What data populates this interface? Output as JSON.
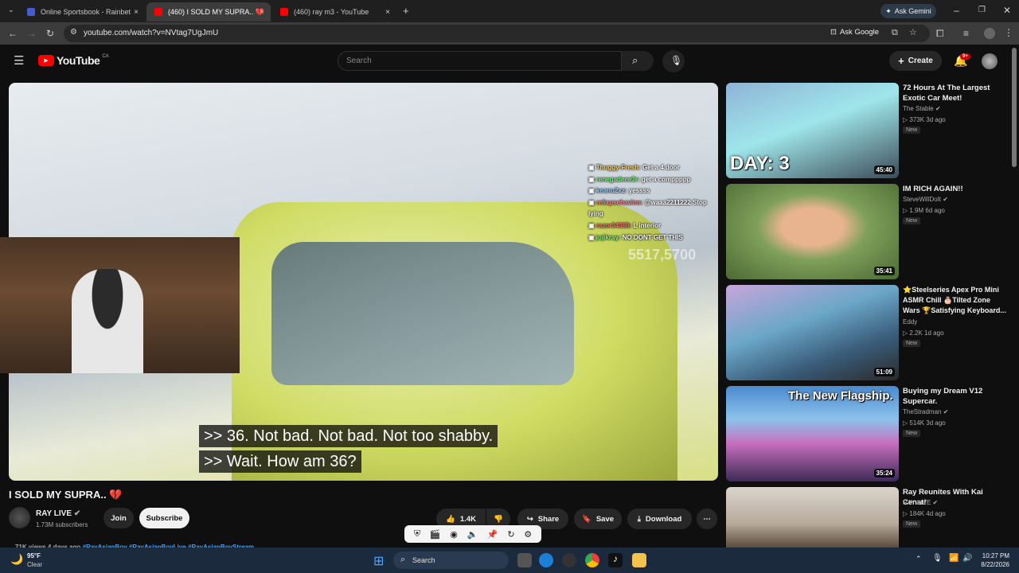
{
  "browser": {
    "tabs": [
      {
        "label": "Online Sportsbook - Rainbet",
        "active": false,
        "favicon_color": "#4a5bd0"
      },
      {
        "label": "(460) I SOLD MY SUPRA.. 💔",
        "active": true,
        "favicon_color": "#ff0000"
      },
      {
        "label": "(460) ray m3 - YouTube",
        "active": false,
        "favicon_color": "#ff0000"
      }
    ],
    "new_tab_label": "+",
    "close_label": "×",
    "ask_gemini": "Ask Gemini",
    "url": "youtube.com/watch?v=NVtag7UgJmU",
    "ask_google": "Ask Google"
  },
  "header": {
    "logo_text": "YouTube",
    "country": "CA",
    "search_placeholder": "Search",
    "create_label": "Create",
    "notifications_badge": "9+"
  },
  "video": {
    "chat_lines": [
      {
        "name": "Thuggy-Fresh:",
        "msg": "Get a 4 door",
        "cls": "n3"
      },
      {
        "name": "renegadeee3r:",
        "msg": "get a comppppp",
        "cls": "n2"
      },
      {
        "name": "keanu2xz:",
        "msg": "yessss",
        "cls": "n2"
      },
      {
        "name": "relixpsehavinn:",
        "msg": "@waaa2211222 Stop lying",
        "cls": "n1"
      },
      {
        "name": "razor34388:",
        "msg": "L interior",
        "cls": "n4"
      },
      {
        "name": "jojikray:",
        "msg": "NO DONT GET THIS",
        "cls": "n2"
      }
    ],
    "overlay_number": "5517,5700",
    "captions": [
      ">> 36. Not bad. Not bad. Not too shabby.",
      ">> Wait. How am 36?"
    ],
    "title": "I SOLD MY SUPRA.. 💔",
    "channel": "RAY LIVE",
    "subscribers": "1.73M subscribers",
    "join_label": "Join",
    "subscribe_label": "Subscribe",
    "likes": "1.4K",
    "share_label": "Share",
    "save_label": "Save",
    "download_label": "Download",
    "views_date": "71K views  4 days ago",
    "hashtags": "#RayAsianBoy #RayAsianBoyLive #RayAsianBoyStream"
  },
  "recommendations": [
    {
      "title": "72 Hours At The Largest Exotic Car Meet!",
      "channel": "The Stable",
      "stats": "▷ 373K  3d ago",
      "badge": "New",
      "duration": "45:40",
      "thumb_text": "DAY: 3"
    },
    {
      "title": "IM RICH AGAIN!!",
      "channel": "SteveWillDoIt",
      "stats": "▷ 1.9M  6d ago",
      "badge": "New",
      "duration": "35:41",
      "thumb_text": ""
    },
    {
      "title": "⭐Steelseries Apex Pro Mini ASMR Chill 🎂Tilted Zone Wars 🏆Satisfying Keyboard...",
      "channel": "Eddy",
      "stats": "▷ 2.2K  1d ago",
      "badge": "New",
      "duration": "51:09",
      "thumb_text": ""
    },
    {
      "title": "Buying my Dream V12 Supercar.",
      "channel": "TheStradman",
      "stats": "▷ 514K  3d ago",
      "badge": "New",
      "duration": "35:24",
      "thumb_text": "The New Flagship."
    },
    {
      "title": "Ray Reunites With Kai Cenat!",
      "channel": "RAY LIVE",
      "stats": "▷ 184K  4d ago",
      "badge": "New",
      "duration": "",
      "thumb_text": ""
    }
  ],
  "taskbar": {
    "weather_temp": "95°F",
    "weather_desc": "Clear",
    "search_label": "Search",
    "time": "10:27 PM",
    "date": "8/22/2026"
  }
}
